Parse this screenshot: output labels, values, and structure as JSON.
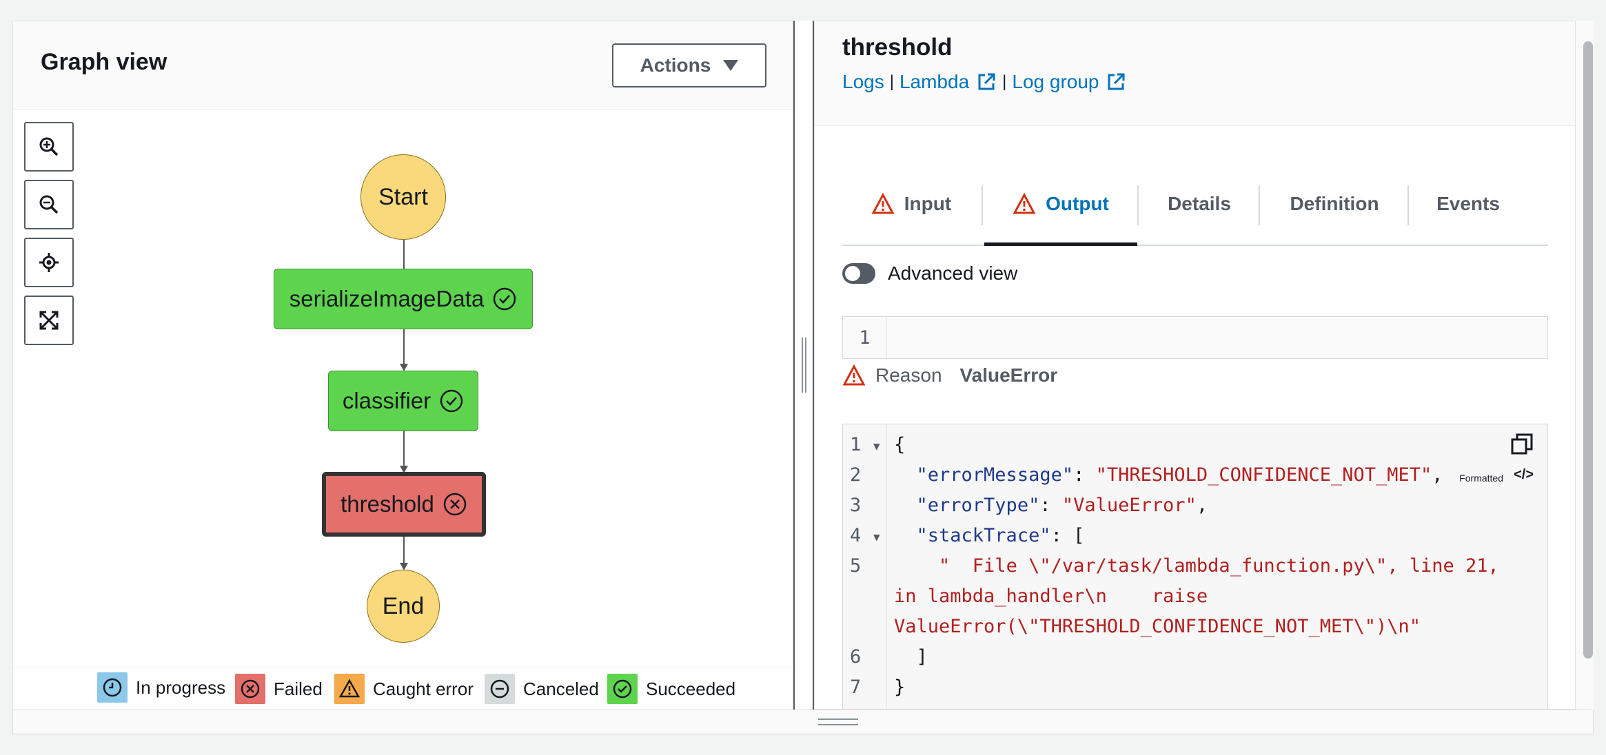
{
  "graph": {
    "title": "Graph view",
    "actions_label": "Actions",
    "nodes": {
      "start": "Start",
      "serialize": "serializeImageData",
      "classifier": "classifier",
      "threshold": "threshold",
      "end": "End"
    }
  },
  "legend": {
    "in_progress": "In progress",
    "failed": "Failed",
    "caught_error": "Caught error",
    "canceled": "Canceled",
    "succeeded": "Succeeded"
  },
  "detail": {
    "title": "threshold",
    "links": {
      "logs": "Logs",
      "lambda": "Lambda",
      "log_group": "Log group",
      "separator": "|"
    },
    "tabs": {
      "input": "Input",
      "output": "Output",
      "details": "Details",
      "definition": "Definition",
      "events": "Events"
    },
    "advanced_view_label": "Advanced view",
    "small_editor_line": "1",
    "reason_label": "Reason",
    "reason_value": "ValueError",
    "formatted_label": "Formatted",
    "formatted_icon": "</>"
  },
  "code": {
    "line_numbers": [
      "1",
      "2",
      "3",
      "4",
      "5",
      "6",
      "7"
    ],
    "l1": "{",
    "l2_key": "\"errorMessage\"",
    "l2_colon": ": ",
    "l2_val": "\"THRESHOLD_CONFIDENCE_NOT_MET\"",
    "l2_comma": ",",
    "l3_key": "\"errorType\"",
    "l3_colon": ": ",
    "l3_val": "\"ValueError\"",
    "l3_comma": ",",
    "l4_key": "\"stackTrace\"",
    "l4_rest": ": [",
    "l5a": "\"  File \\\"/var/task/lambda_function.py\\\", line 21,",
    "l5b": "in lambda_handler\\n    raise",
    "l5c": "ValueError(\\\"THRESHOLD_CONFIDENCE_NOT_MET\\\")\\n\"",
    "l6": "]",
    "l7": "}"
  },
  "colors": {
    "node_start_end": "#fad97c",
    "node_succeeded": "#5ed44e",
    "node_failed": "#e3706b",
    "link_blue": "#0073bb",
    "warning_red": "#d13212",
    "legend_in_progress": "#8cc8ea",
    "legend_failed": "#e3706b",
    "legend_caught": "#f5a94a",
    "legend_canceled": "#d5dbdb",
    "legend_succeeded": "#5ed44e"
  },
  "icons": [
    "zoom-in-icon",
    "zoom-out-icon",
    "center-icon",
    "fit-screen-icon",
    "check-circle-icon",
    "x-circle-icon",
    "external-link-icon",
    "warning-icon",
    "copy-icon",
    "clock-icon",
    "minus-circle-icon"
  ]
}
